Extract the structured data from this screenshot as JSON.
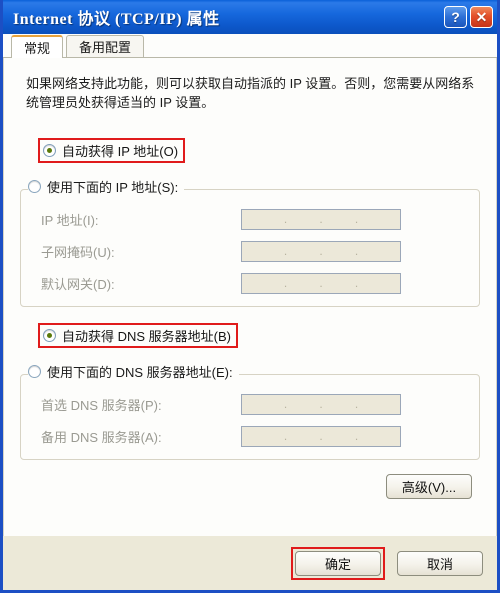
{
  "window": {
    "title": "Internet 协议 (TCP/IP) 属性",
    "help_button": "?",
    "close_button": "✕",
    "accent_titlebar": "#1668dd",
    "highlight_color": "#e01b1b",
    "face_color": "#ece9d8"
  },
  "tabs": [
    {
      "label": "常规",
      "active": true
    },
    {
      "label": "备用配置",
      "active": false
    }
  ],
  "description": "如果网络支持此功能，则可以获取自动指派的 IP 设置。否则，您需要从网络系统管理员处获得适当的 IP 设置。",
  "ip_section": {
    "auto_option": "自动获得 IP 地址(O)",
    "manual_option": "使用下面的 IP 地址(S):",
    "fields": [
      {
        "label": "IP 地址(I):",
        "value": "",
        "enabled": false
      },
      {
        "label": "子网掩码(U):",
        "value": "",
        "enabled": false
      },
      {
        "label": "默认网关(D):",
        "value": "",
        "enabled": false
      }
    ]
  },
  "dns_section": {
    "auto_option": "自动获得 DNS 服务器地址(B)",
    "manual_option": "使用下面的 DNS 服务器地址(E):",
    "fields": [
      {
        "label": "首选 DNS 服务器(P):",
        "value": "",
        "enabled": false
      },
      {
        "label": "备用 DNS 服务器(A):",
        "value": "",
        "enabled": false
      }
    ]
  },
  "advanced_button": "高级(V)...",
  "footer": {
    "ok_button": "确定",
    "cancel_button": "取消"
  }
}
